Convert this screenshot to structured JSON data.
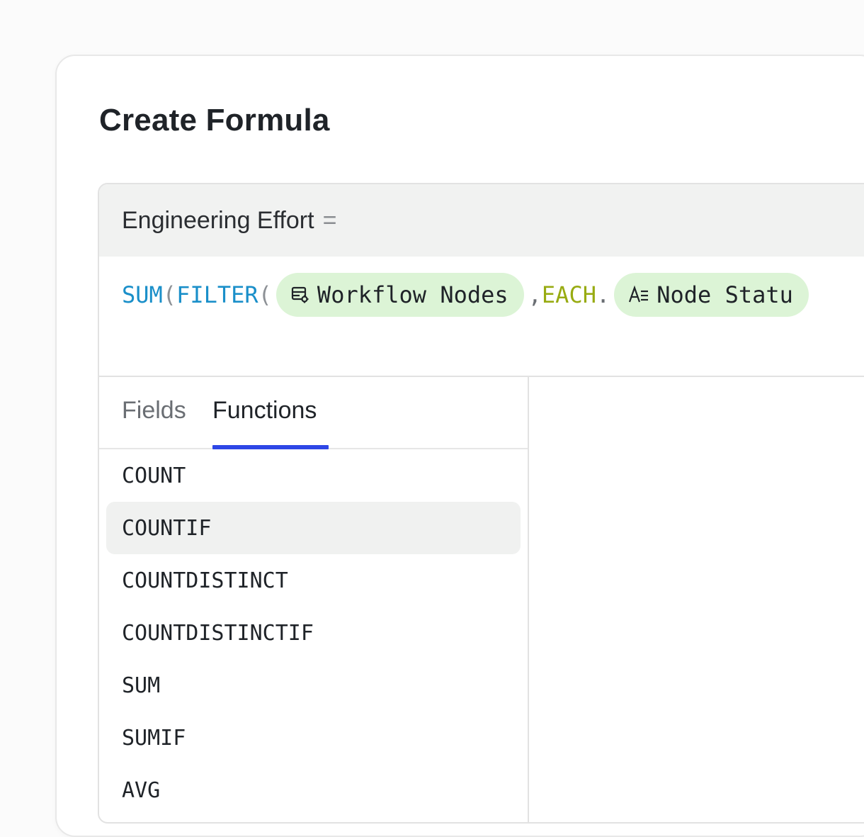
{
  "dialog": {
    "title": "Create Formula"
  },
  "field": {
    "name": "Engineering Effort",
    "equals": "="
  },
  "formula": {
    "sum": "SUM",
    "filter": "FILTER",
    "open_paren": "(",
    "chip_workflow": {
      "label": "Workflow Nodes",
      "icon": "table-settings-icon"
    },
    "comma": ",",
    "each": "EACH",
    "dot": ".",
    "chip_status": {
      "label": "Node Statu",
      "icon": "text-field-icon"
    }
  },
  "tabs": {
    "fields": "Fields",
    "functions": "Functions",
    "active": "Functions"
  },
  "functions": [
    "COUNT",
    "COUNTIF",
    "COUNTDISTINCT",
    "COUNTDISTINCTIF",
    "SUM",
    "SUMIF",
    "AVG"
  ],
  "selected_function": "COUNTIF",
  "colors": {
    "function_name": "#1a8fc9",
    "each_keyword": "#98ab12",
    "chip_bg": "#dcf4d6",
    "tab_accent": "#2e47e6",
    "selected_row": "#f0f1f0"
  }
}
